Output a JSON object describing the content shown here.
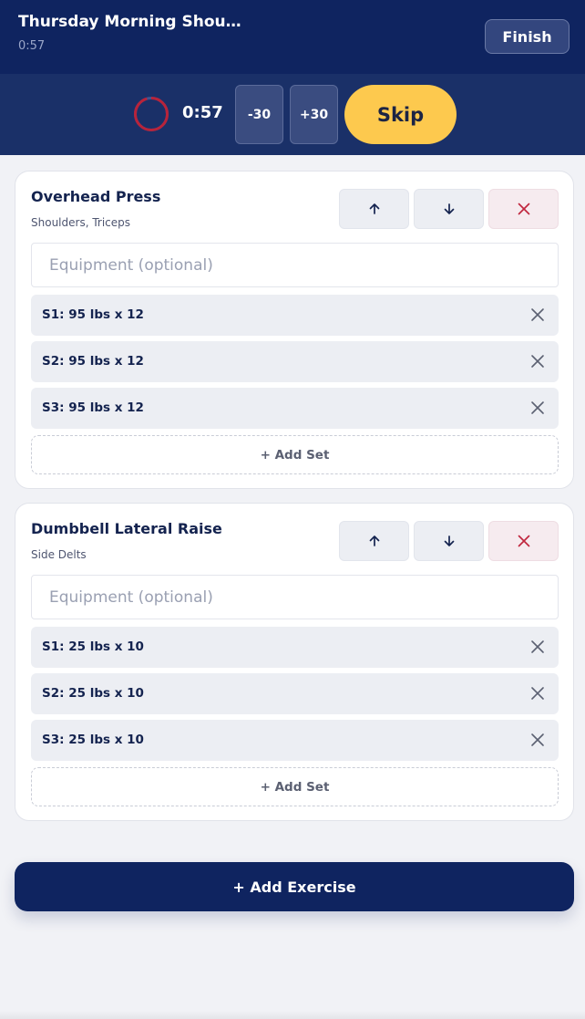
{
  "header": {
    "workout_title": "Thursday Morning Should...",
    "elapsed": "0:57",
    "finish_label": "Finish"
  },
  "rest_timer": {
    "time": "0:57",
    "minus_label": "-30",
    "plus_label": "+30",
    "skip_label": "Skip",
    "ring_color": "#b8233a"
  },
  "exercises": [
    {
      "name": "Overhead Press",
      "muscles": "Shoulders, Triceps",
      "equipment_placeholder": "Equipment (optional)",
      "sets": [
        "S1: 95 lbs x 12",
        "S2: 95 lbs x 12",
        "S3: 95 lbs x 12"
      ],
      "add_set_label": "+ Add Set"
    },
    {
      "name": "Dumbbell Lateral Raise",
      "muscles": "Side Delts",
      "equipment_placeholder": "Equipment (optional)",
      "sets": [
        "S1: 25 lbs x 10",
        "S2: 25 lbs x 10",
        "S3: 25 lbs x 10"
      ],
      "add_set_label": "+ Add Set"
    }
  ],
  "add_exercise_label": "+ Add Exercise",
  "icons": {
    "move_up": "arrow-up-icon",
    "move_down": "arrow-down-icon",
    "remove_exercise": "close-icon",
    "remove_set": "close-icon"
  },
  "colors": {
    "navy": "#0f2460",
    "accent_yellow": "#fdc94e",
    "danger_red": "#c1283f"
  }
}
